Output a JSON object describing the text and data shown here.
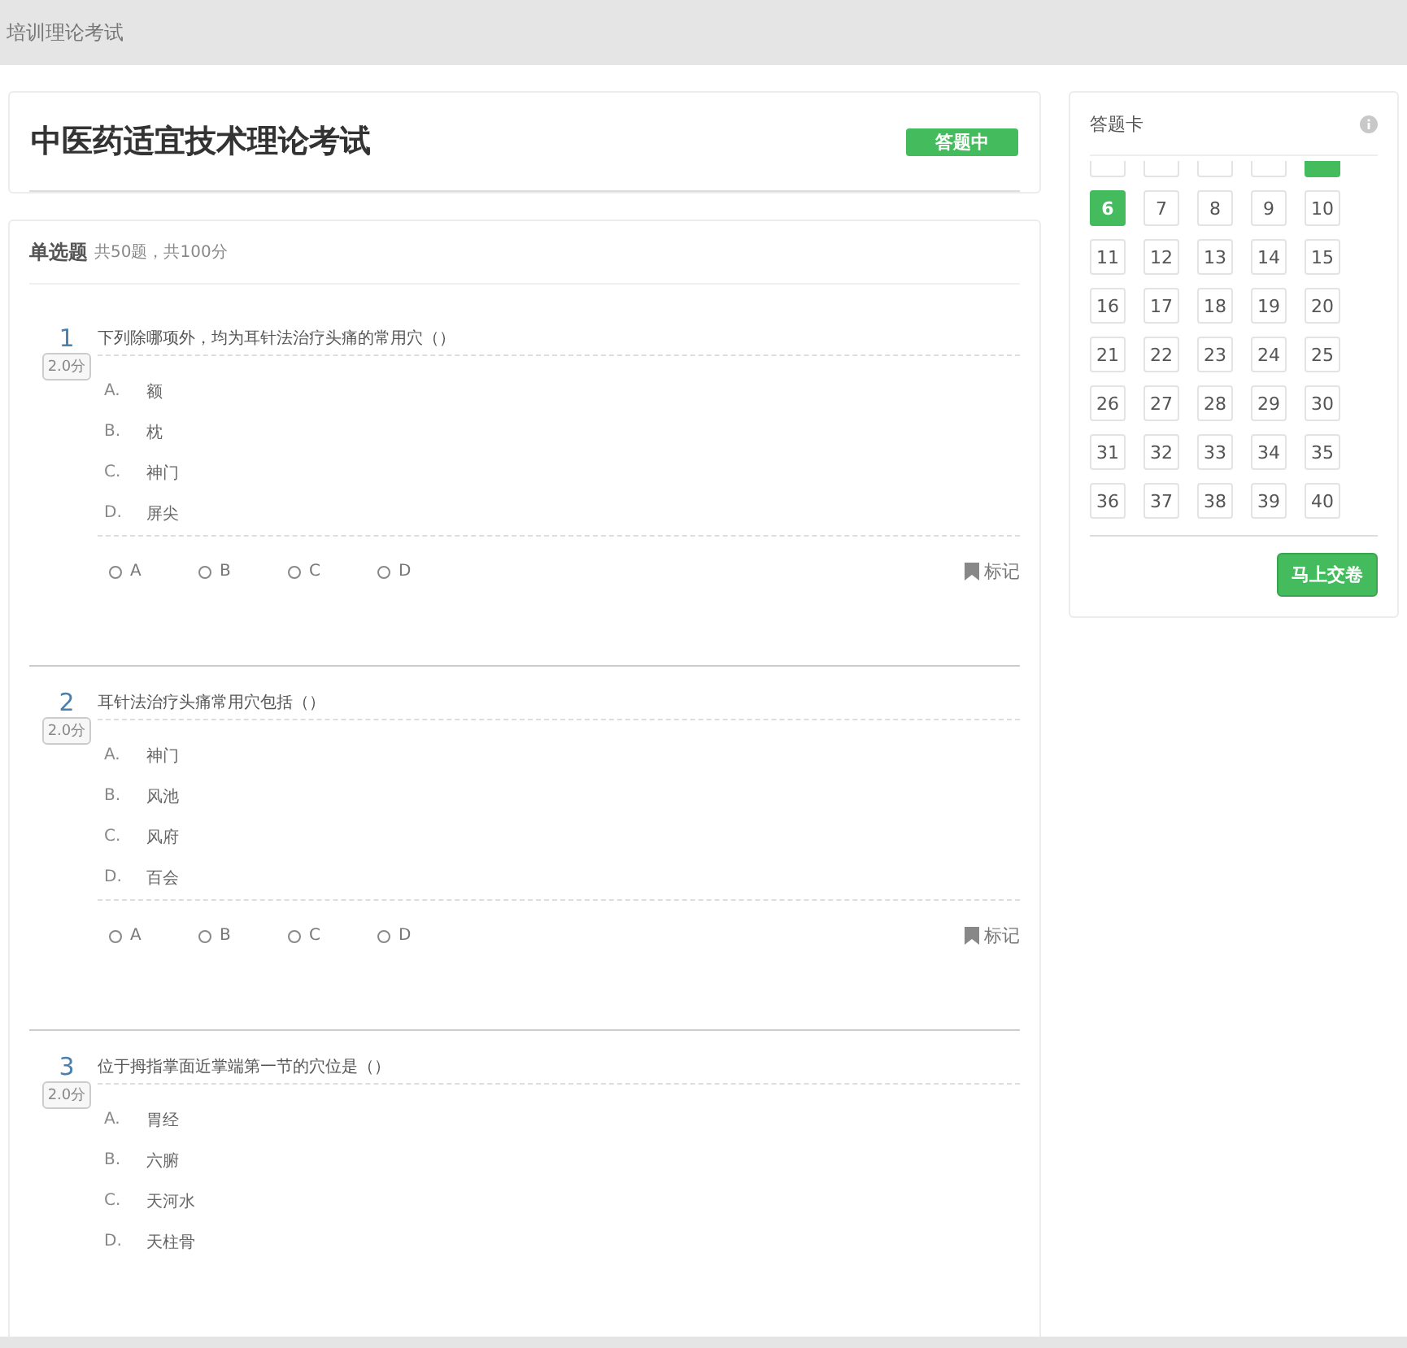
{
  "header": {
    "title": "培训理论考试"
  },
  "exam": {
    "title": "中医药适宜技术理论考试",
    "status": "答题中"
  },
  "section": {
    "title": "单选题",
    "summary": "共50题，共100分"
  },
  "questions": [
    {
      "number": "1",
      "score": "2.0分",
      "text": "下列除哪项外，均为耳针法治疗头痛的常用穴（）",
      "options": [
        {
          "letter": "A.",
          "text": "额"
        },
        {
          "letter": "B.",
          "text": "枕"
        },
        {
          "letter": "C.",
          "text": "神门"
        },
        {
          "letter": "D.",
          "text": "屏尖"
        }
      ],
      "choices": [
        {
          "label": "A",
          "selected": false
        },
        {
          "label": "B",
          "selected": false
        },
        {
          "label": "C",
          "selected": false
        },
        {
          "label": "D",
          "selected": false
        }
      ],
      "mark": "标记",
      "marked": false
    },
    {
      "number": "2",
      "score": "2.0分",
      "text": "耳针法治疗头痛常用穴包括（）",
      "options": [
        {
          "letter": "A.",
          "text": "神门"
        },
        {
          "letter": "B.",
          "text": "风池"
        },
        {
          "letter": "C.",
          "text": "风府"
        },
        {
          "letter": "D.",
          "text": "百会"
        }
      ],
      "choices": [
        {
          "label": "A",
          "selected": false
        },
        {
          "label": "B",
          "selected": false
        },
        {
          "label": "C",
          "selected": false
        },
        {
          "label": "D",
          "selected": false
        }
      ],
      "mark": "标记",
      "marked": false
    },
    {
      "number": "3",
      "score": "2.0分",
      "text": "位于拇指掌面近掌端第一节的穴位是（）",
      "options": [
        {
          "letter": "A.",
          "text": "胃经"
        },
        {
          "letter": "B.",
          "text": "六腑"
        },
        {
          "letter": "C.",
          "text": "天河水"
        },
        {
          "letter": "D.",
          "text": "天柱骨"
        }
      ]
    }
  ],
  "answer_card": {
    "title": "答题卡",
    "submit": "马上交卷",
    "items": [
      {
        "answered": false
      },
      {
        "answered": false
      },
      {
        "answered": false
      },
      {
        "answered": false
      },
      {
        "answered": true
      },
      {
        "label": "6",
        "answered": true
      },
      {
        "label": "7",
        "answered": false
      },
      {
        "label": "8",
        "answered": false
      },
      {
        "label": "9",
        "answered": false
      },
      {
        "label": "10",
        "answered": false
      },
      {
        "label": "11",
        "answered": false
      },
      {
        "label": "12",
        "answered": false
      },
      {
        "label": "13",
        "answered": false
      },
      {
        "label": "14",
        "answered": false
      },
      {
        "label": "15",
        "answered": false
      },
      {
        "label": "16",
        "answered": false
      },
      {
        "label": "17",
        "answered": false
      },
      {
        "label": "18",
        "answered": false
      },
      {
        "label": "19",
        "answered": false
      },
      {
        "label": "20",
        "answered": false
      },
      {
        "label": "21",
        "answered": false
      },
      {
        "label": "22",
        "answered": false
      },
      {
        "label": "23",
        "answered": false
      },
      {
        "label": "24",
        "answered": false
      },
      {
        "label": "25",
        "answered": false
      },
      {
        "label": "26",
        "answered": false
      },
      {
        "label": "27",
        "answered": false
      },
      {
        "label": "28",
        "answered": false
      },
      {
        "label": "29",
        "answered": false
      },
      {
        "label": "30",
        "answered": false
      },
      {
        "label": "31",
        "answered": false
      },
      {
        "label": "32",
        "answered": false
      },
      {
        "label": "33",
        "answered": false
      },
      {
        "label": "34",
        "answered": false
      },
      {
        "label": "35",
        "answered": false
      },
      {
        "label": "36",
        "answered": false
      },
      {
        "label": "37",
        "answered": false
      },
      {
        "label": "38",
        "answered": false
      },
      {
        "label": "39",
        "answered": false
      },
      {
        "label": "40",
        "answered": false
      }
    ]
  }
}
